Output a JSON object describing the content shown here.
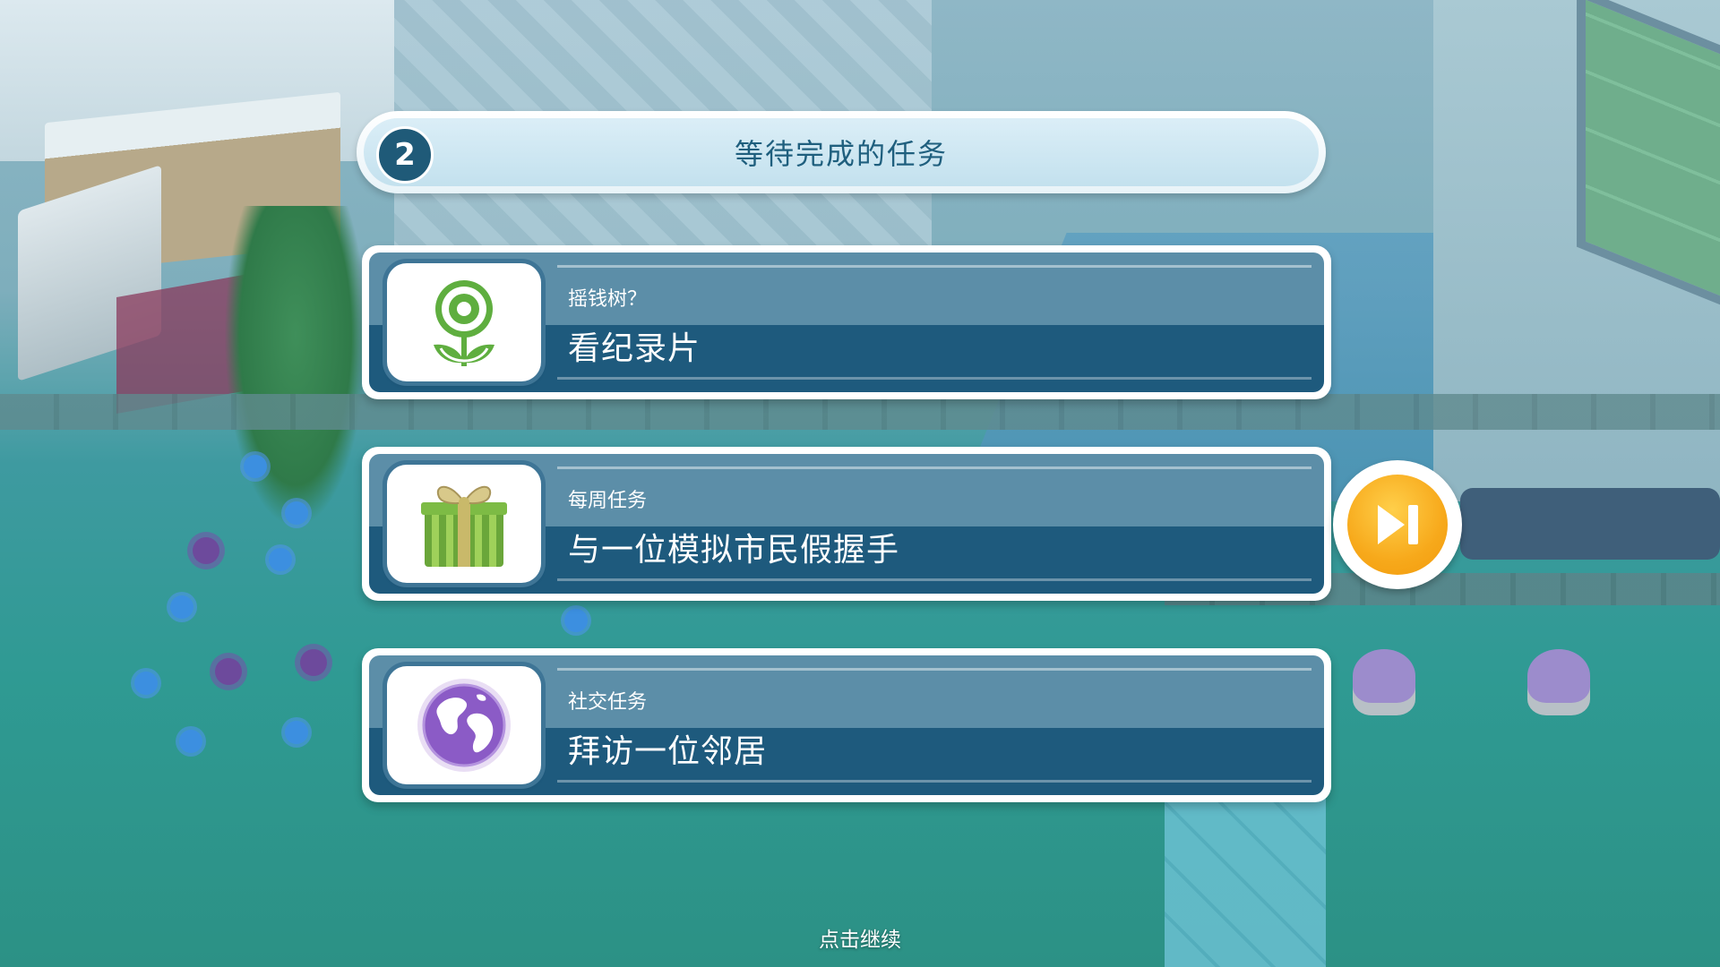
{
  "header": {
    "pending_count": "2",
    "title": "等待完成的任务"
  },
  "tasks": [
    {
      "category": "摇钱树？",
      "text": "看纪录片",
      "icon": "flower-icon"
    },
    {
      "category": "每周任务",
      "text": "与一位模拟市民假握手",
      "icon": "gift-icon"
    },
    {
      "category": "社交任务",
      "text": "拜访一位邻居",
      "icon": "globe-icon"
    }
  ],
  "skip_button": {
    "icon": "skip-forward-icon"
  },
  "footer": {
    "tap_to_continue": "点击继续"
  },
  "colors": {
    "badge": "#1f5a78",
    "card_top": "#5c8ea8",
    "card_bottom": "#1e5a7d",
    "skip_button": "#f7a91b",
    "title_text": "#1f5f7e"
  }
}
